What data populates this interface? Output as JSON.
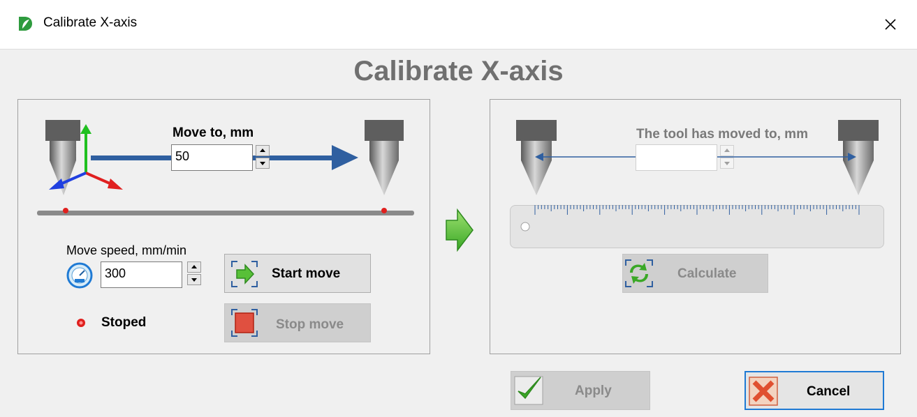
{
  "window": {
    "title": "Calibrate X-axis"
  },
  "heading": "Calibrate X-axis",
  "move_panel": {
    "move_to_label": "Move to, mm",
    "move_to_value": "50",
    "speed_label": "Move speed, mm/min",
    "speed_value": "300",
    "start_label": "Start move",
    "stop_label": "Stop move",
    "status_text": "Stoped",
    "status_color": "#e0201e"
  },
  "measure_panel": {
    "moved_label": "The tool has moved to, mm",
    "moved_value": "",
    "calculate_label": "Calculate"
  },
  "footer": {
    "apply_label": "Apply",
    "cancel_label": "Cancel"
  },
  "colors": {
    "arrow_blue": "#2f5fa0",
    "heading_gray": "#707070",
    "focus_border": "#1f7ad4"
  }
}
